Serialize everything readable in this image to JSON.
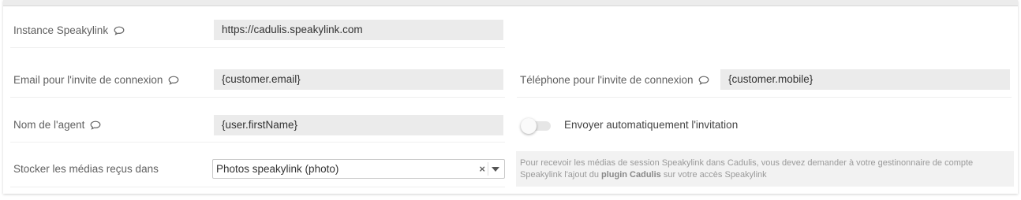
{
  "fields": {
    "instance": {
      "label": "Instance Speakylink",
      "value": "https://cadulis.speakylink.com"
    },
    "email": {
      "label": "Email pour l'invite de connexion",
      "value": "{customer.email}"
    },
    "phone": {
      "label": "Téléphone pour l'invite de connexion",
      "value": "{customer.mobile}"
    },
    "agent": {
      "label": "Nom de l'agent",
      "value": "{user.firstName}"
    },
    "auto_send": {
      "label": "Envoyer automatiquement l'invitation",
      "enabled": false
    },
    "media": {
      "label": "Stocker les médias reçus dans",
      "selected": "Photos speakylink (photo)",
      "clear_symbol": "×"
    }
  },
  "info": {
    "before": "Pour recevoir les médias de session Speakylink dans Cadulis, vous devez demander à votre gestinonnaire de compte Speakylink l'ajout du ",
    "bold": "plugin Cadulis",
    "after": " sur votre accès Speakylink"
  },
  "icons": {
    "help": "speech-bubble-icon",
    "dropdown": "caret-down-icon",
    "clear": "clear-icon"
  },
  "colors": {
    "field_bg": "#ebebeb",
    "label": "#5f5f5f",
    "info_bg": "#f2f2f2"
  }
}
